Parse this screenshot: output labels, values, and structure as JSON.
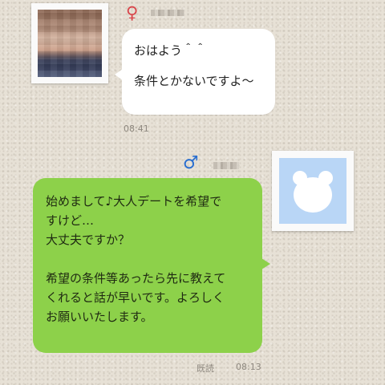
{
  "messages": {
    "incoming": {
      "gender_symbol": "♀",
      "lines": [
        "おはよう＾＾",
        "",
        "条件とかないですよ～"
      ],
      "time": "08:41"
    },
    "outgoing": {
      "gender_symbol": "♂",
      "lines": [
        "始めまして♪大人デートを希望で",
        "すけど…",
        "大丈夫ですか？",
        "",
        "希望の条件等あったら先に教えて",
        "くれると話が早いです。よろしく",
        "お願いいたします。"
      ],
      "read_status": "既読",
      "time": "08:13"
    }
  },
  "colors": {
    "background": "#e7e1d6",
    "incoming_bubble": "#ffffff",
    "outgoing_bubble": "#8dd14a",
    "female_symbol": "#d8464b",
    "male_symbol": "#2a6fd0",
    "avatar_bg": "#b9d6f6"
  },
  "icons": {
    "incoming_avatar": "pixelated-photo-avatar",
    "outgoing_avatar": "bear-head-icon"
  }
}
